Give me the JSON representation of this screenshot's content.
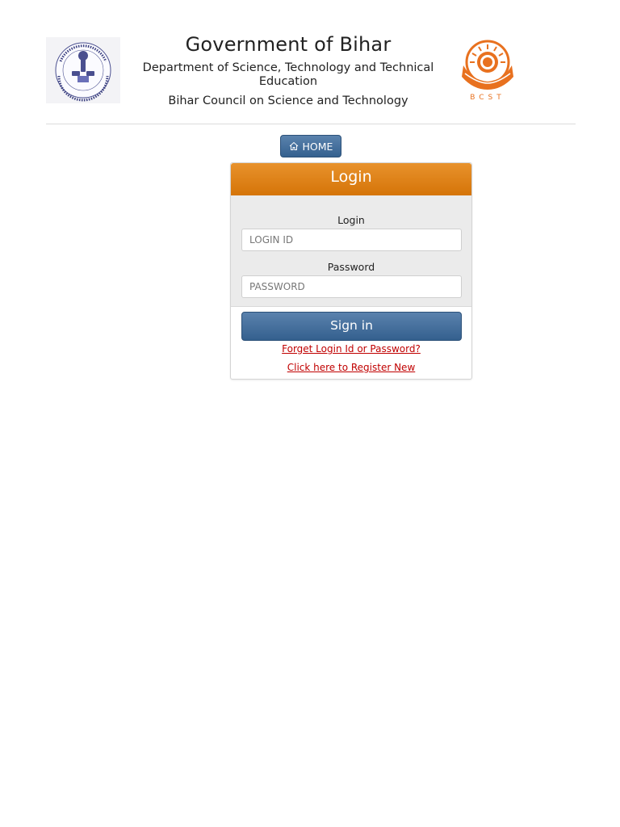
{
  "header": {
    "title": "Government of Bihar",
    "department": "Department of Science, Technology and Technical Education",
    "council": "Bihar Council on Science and Technology",
    "left_logo_icon": "dst-bihar-emblem-icon",
    "right_logo_icon": "bcst-sun-logo-icon",
    "right_logo_text": "BCST"
  },
  "nav": {
    "home_label": "HOME",
    "home_icon": "home-icon"
  },
  "login": {
    "panel_title": "Login",
    "login_label": "Login",
    "login_placeholder": "LOGIN ID",
    "password_label": "Password",
    "password_placeholder": "PASSWORD",
    "signin_label": "Sign in",
    "forgot_link": "Forget Login Id or Password?",
    "register_link": "Click here to Register New"
  },
  "colors": {
    "accent_orange": "#d57408",
    "button_blue": "#35618f",
    "link_red": "#c00000",
    "panel_body_gray": "#ebebeb"
  }
}
